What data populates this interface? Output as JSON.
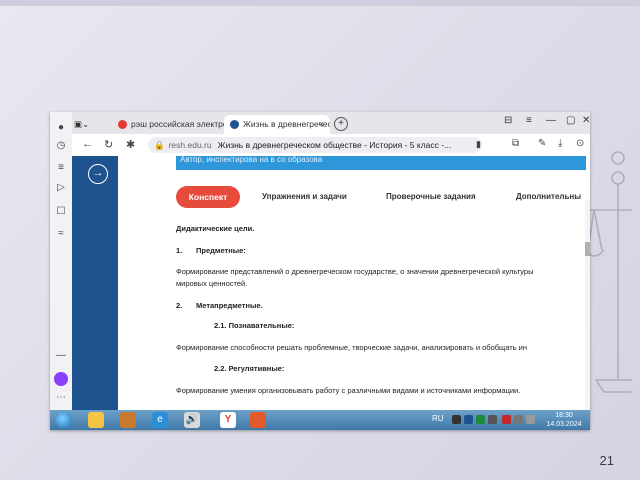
{
  "slide": {
    "number": "21"
  },
  "browser": {
    "tabs": [
      {
        "label": "рэш российская электрон",
        "active": false
      },
      {
        "label": "Жизнь в древнегреческом",
        "active": true
      }
    ],
    "new_tab": "+",
    "address": {
      "domain": "resh.edu.ru",
      "title": "Жизнь в древнегреческом обществе - История - 5 класс -..."
    }
  },
  "page": {
    "header_strip": "Автор, инспектирова на в со образова",
    "tabs": [
      "Конспект",
      "Упражнения и задачи",
      "Проверочные задания",
      "Дополнительны"
    ],
    "lines": [
      "Дидактические цели.",
      "1.",
      "Предметные:",
      "Формирование представлений о древнегреческом государстве, о значении древнегреческой культуры",
      "мировых ценностей.",
      "2.",
      "Метапредметные.",
      "2.1. Познавательные:",
      "Формирование способности решать проблемные, творческие задачи, анализировать и обобщать ин",
      "2.2. Регулятивные:",
      "Формирование умения организовывать работу с различными видами и источниками информации."
    ]
  },
  "taskbar": {
    "language": "RU",
    "time": "18:30",
    "date": "14.03.2024"
  }
}
